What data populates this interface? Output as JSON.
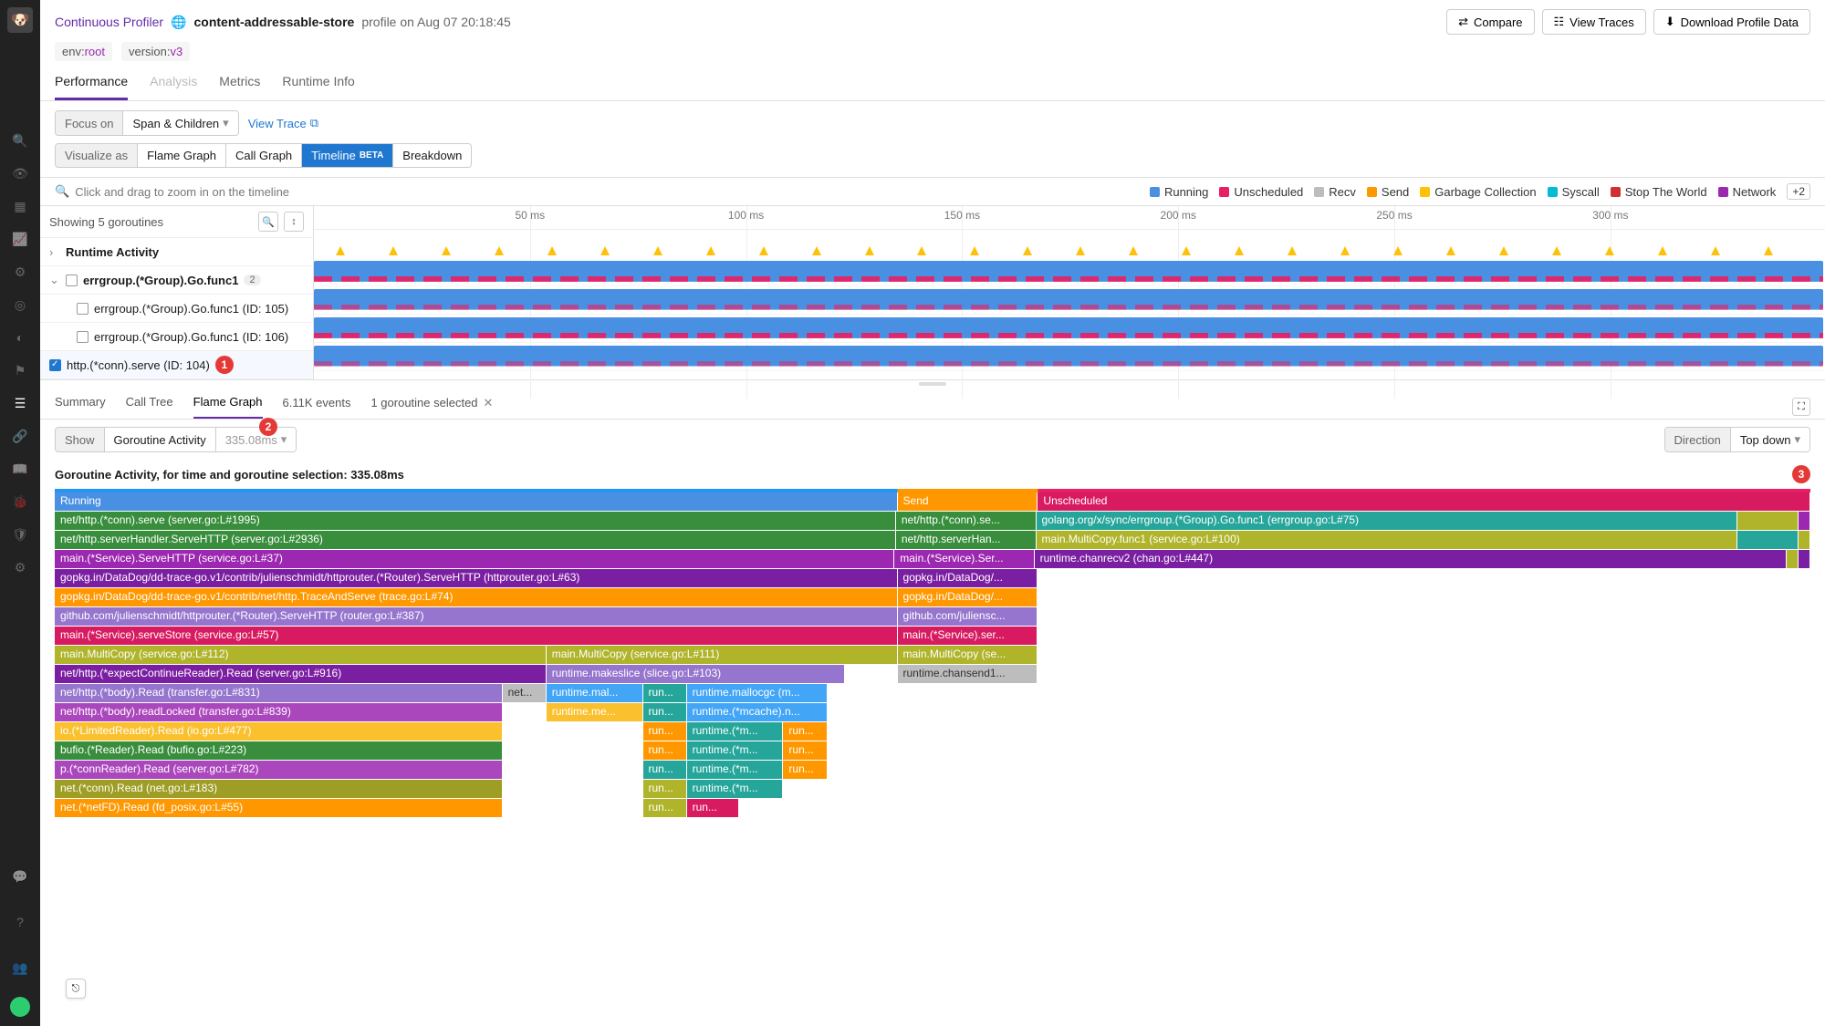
{
  "header": {
    "breadcrumb": "Continuous Profiler",
    "service": "content-addressable-store",
    "profile_on": "profile on Aug 07 20:18:45",
    "actions": {
      "compare": "Compare",
      "view_traces": "View Traces",
      "download": "Download Profile Data"
    },
    "tags": {
      "env_label": "env:",
      "env_val": "root",
      "version_label": "version:",
      "version_val": "v3"
    },
    "tabs": {
      "performance": "Performance",
      "analysis": "Analysis",
      "metrics": "Metrics",
      "runtime": "Runtime Info"
    }
  },
  "controls": {
    "focus_label": "Focus on",
    "focus_value": "Span & Children",
    "view_trace": "View Trace",
    "visualize_label": "Visualize as",
    "flame_graph": "Flame Graph",
    "call_graph": "Call Graph",
    "timeline": "Timeline",
    "timeline_badge": "BETA",
    "breakdown": "Breakdown"
  },
  "timeline": {
    "zoom_hint": "Click and drag to zoom in on the timeline",
    "legend": {
      "running": "Running",
      "unscheduled": "Unscheduled",
      "recv": "Recv",
      "send": "Send",
      "gc": "Garbage Collection",
      "syscall": "Syscall",
      "stw": "Stop The World",
      "network": "Network",
      "more": "+2"
    },
    "showing": "Showing 5 goroutines",
    "ruler": [
      "50 ms",
      "100 ms",
      "150 ms",
      "200 ms",
      "250 ms",
      "300 ms"
    ],
    "rows": {
      "runtime_activity": "Runtime Activity",
      "group": "errgroup.(*Group).Go.func1",
      "group_count": "2",
      "g105": "errgroup.(*Group).Go.func1 (ID: 105)",
      "g106": "errgroup.(*Group).Go.func1 (ID: 106)",
      "g104": "http.(*conn).serve (ID: 104)"
    },
    "markers": {
      "m1": "1"
    }
  },
  "bottom": {
    "tabs": {
      "summary": "Summary",
      "call_tree": "Call Tree",
      "flame_graph": "Flame Graph"
    },
    "events": "6.11K events",
    "selected": "1 goroutine selected",
    "marker2": "2",
    "show_label": "Show",
    "show_value": "Goroutine Activity",
    "show_time": "335.08ms",
    "direction_label": "Direction",
    "direction_value": "Top down",
    "title": "Goroutine Activity, for time and goroutine selection: 335.08ms",
    "marker3": "3"
  },
  "flame": {
    "r1": {
      "running": "Running",
      "send": "Send",
      "unscheduled": "Unscheduled"
    },
    "r2": {
      "a": "net/http.(*conn).serve (server.go:L#1995)",
      "b": "net/http.(*conn).se...",
      "c": "golang.org/x/sync/errgroup.(*Group).Go.func1 (errgroup.go:L#75)"
    },
    "r3": {
      "a": "net/http.serverHandler.ServeHTTP (server.go:L#2936)",
      "b": "net/http.serverHan...",
      "c": "main.MultiCopy.func1 (service.go:L#100)"
    },
    "r4": {
      "a": "main.(*Service).ServeHTTP (service.go:L#37)",
      "b": "main.(*Service).Ser...",
      "c": "runtime.chanrecv2 (chan.go:L#447)"
    },
    "r5": {
      "a": "gopkg.in/DataDog/dd-trace-go.v1/contrib/julienschmidt/httprouter.(*Router).ServeHTTP (httprouter.go:L#63)",
      "b": "gopkg.in/DataDog/..."
    },
    "r6": {
      "a": "gopkg.in/DataDog/dd-trace-go.v1/contrib/net/http.TraceAndServe (trace.go:L#74)",
      "b": "gopkg.in/DataDog/..."
    },
    "r7": {
      "a": "github.com/julienschmidt/httprouter.(*Router).ServeHTTP (router.go:L#387)",
      "b": "github.com/juliensc..."
    },
    "r8": {
      "a": "main.(*Service).serveStore (service.go:L#57)",
      "b": "main.(*Service).ser..."
    },
    "r9": {
      "a": "main.MultiCopy (service.go:L#112)",
      "b": "main.MultiCopy (service.go:L#111)",
      "c": "main.MultiCopy (se..."
    },
    "r10": {
      "a": "net/http.(*expectContinueReader).Read (server.go:L#916)",
      "b": "runtime.makeslice (slice.go:L#103)",
      "c": "runtime.chansend1..."
    },
    "r11": {
      "a": "net/http.(*body).Read (transfer.go:L#831)",
      "b": "net...",
      "c": "runtime.mal...",
      "d": "run...",
      "e": "runtime.mallocgc (m..."
    },
    "r12": {
      "a": "net/http.(*body).readLocked (transfer.go:L#839)",
      "b": "runtime.me...",
      "c": "run...",
      "d": "runtime.(*mcache).n..."
    },
    "r13": {
      "a": "io.(*LimitedReader).Read (io.go:L#477)",
      "b": "run...",
      "c": "runtime.(*m...",
      "d": "run..."
    },
    "r14": {
      "a": "bufio.(*Reader).Read (bufio.go:L#223)",
      "b": "run...",
      "c": "runtime.(*m...",
      "d": "run..."
    },
    "r15": {
      "a": "p.(*connReader).Read (server.go:L#782)",
      "b": "run...",
      "c": "runtime.(*m...",
      "d": "run..."
    },
    "r16": {
      "a": "net.(*conn).Read (net.go:L#183)",
      "b": "run...",
      "c": "runtime.(*m..."
    },
    "r17": {
      "a": "net.(*netFD).Read (fd_posix.go:L#55)",
      "b": "run...",
      "c": "run..."
    }
  }
}
